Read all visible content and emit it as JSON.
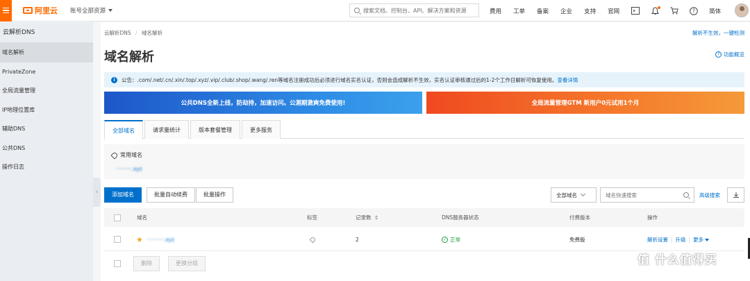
{
  "header": {
    "brand": "阿里云",
    "account_selector": "账号全部资源",
    "search_placeholder": "搜索文档、控制台、API、解决方案和资源",
    "nav": [
      "费用",
      "工单",
      "备案",
      "企业",
      "支持",
      "官网"
    ],
    "language": "简体",
    "icons": [
      "terminal-icon",
      "bell-icon",
      "cart-icon",
      "help-icon"
    ],
    "accent": "#ff6a00"
  },
  "sidebar": {
    "title": "云解析DNS",
    "items": [
      {
        "label": "域名解析",
        "active": true
      },
      {
        "label": "PrivateZone",
        "active": false
      },
      {
        "label": "全局流量管理",
        "active": false
      },
      {
        "label": "IP地理位置库",
        "active": false
      },
      {
        "label": "辅助DNS",
        "active": false
      },
      {
        "label": "公共DNS",
        "active": false
      },
      {
        "label": "操作日志",
        "active": false
      }
    ]
  },
  "main": {
    "breadcrumb": [
      "云解析DNS",
      "域名解析"
    ],
    "top_link": "解析不生效，一键检测",
    "page_title": "域名解析",
    "overview_link": "功能概览",
    "notice": {
      "text": "公告：.com/.net/.cn/.xin/.top/.xyz/.vip/.club/.shop/.wang/.ren等域名注册成功后必须进行域名实名认证，否则会造成解析不生效，实名认证审核通过后的1-2个工作日解析可恢复使用。",
      "link": "查看详情"
    },
    "banners": {
      "left": "公共DNS全新上线，防劫持，加速访问。公测期激爽免费使用!",
      "right": "全局流量管理GTM 新用户0元试用1个月",
      "left_color": "#1d57c9",
      "right_color": "#f04a20"
    },
    "tabs": [
      "全部域名",
      "请求量统计",
      "版本套餐管理",
      "更多服务"
    ],
    "active_tab": "全部域名",
    "frequent": {
      "title": "常用域名",
      "domain": "·········.xyz"
    },
    "toolbar": {
      "add": "添加域名",
      "batch_renew": "批量自动续费",
      "batch_ops": "批量操作",
      "filter_select": "全部域名",
      "search_placeholder": "域名快速搜索",
      "advanced": "高级搜索"
    },
    "table": {
      "columns": [
        "域名",
        "标签",
        "记录数",
        "DNS服务器状态",
        "付费版本",
        "操作"
      ],
      "rows": [
        {
          "domain": "··········.xyz",
          "starred": true,
          "records": "2",
          "dns_status": "正常",
          "plan": "免费版",
          "actions": [
            "解析设置",
            "升级",
            "更多"
          ]
        }
      ]
    },
    "footer": {
      "delete": "删除",
      "change_group": "更换分组"
    }
  },
  "watermark": "值 什么值得买",
  "status_colors": {
    "ok": "#1e9e3c",
    "link": "#0070cc"
  }
}
